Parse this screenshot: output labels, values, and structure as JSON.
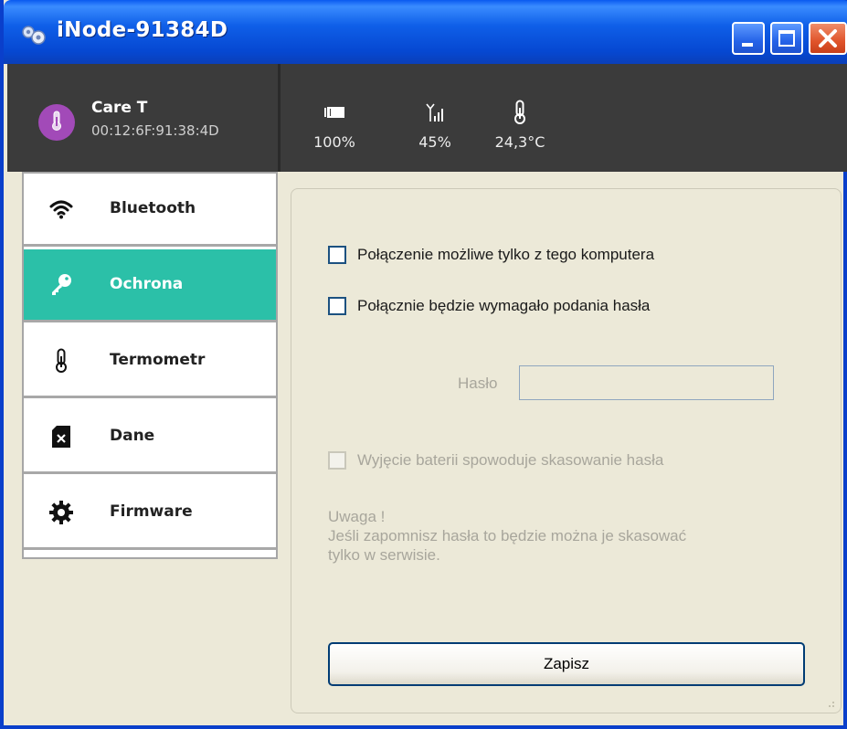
{
  "window": {
    "title": "iNode-91384D",
    "title_icon": "gears-icon",
    "controls": [
      "minimize-icon",
      "maximize-icon",
      "close-icon"
    ]
  },
  "device": {
    "name": "Care T",
    "mac": "00:12:6F:91:38:4D",
    "avatar_icon": "thermometer-icon",
    "avatar_color": "#A24AB8"
  },
  "status": {
    "battery": {
      "icon": "battery-icon",
      "value": "100%"
    },
    "signal": {
      "icon": "signal-icon",
      "value": "45%"
    },
    "temperature": {
      "icon": "thermometer-icon",
      "value": "24,3°C"
    }
  },
  "sidebar": {
    "active_color": "#2BC0A8",
    "items": [
      {
        "label": "Bluetooth",
        "icon": "wifi-icon",
        "active": false
      },
      {
        "label": "Ochrona",
        "icon": "key-icon",
        "active": true
      },
      {
        "label": "Termometr",
        "icon": "thermometer-icon",
        "active": false
      },
      {
        "label": "Dane",
        "icon": "sd-card-icon",
        "active": false
      },
      {
        "label": "Firmware",
        "icon": "gear-icon",
        "active": false
      }
    ]
  },
  "protection": {
    "option_local_only": {
      "label": "Połączenie możliwe tylko z tego komputera",
      "checked": false,
      "enabled": true
    },
    "option_require_password": {
      "label": "Połącznie będzie wymagało podania hasła",
      "checked": false,
      "enabled": true
    },
    "password": {
      "label": "Hasło",
      "value": "",
      "enabled": false
    },
    "option_battery_reset": {
      "label": "Wyjęcie baterii spowoduje skasowanie hasła",
      "checked": false,
      "enabled": false
    },
    "note_title": "Uwaga !",
    "note_line1": "Jeśli zapomnisz hasła to będzie można je skasować",
    "note_line2": "tylko w serwisie.",
    "save_label": "Zapisz"
  }
}
